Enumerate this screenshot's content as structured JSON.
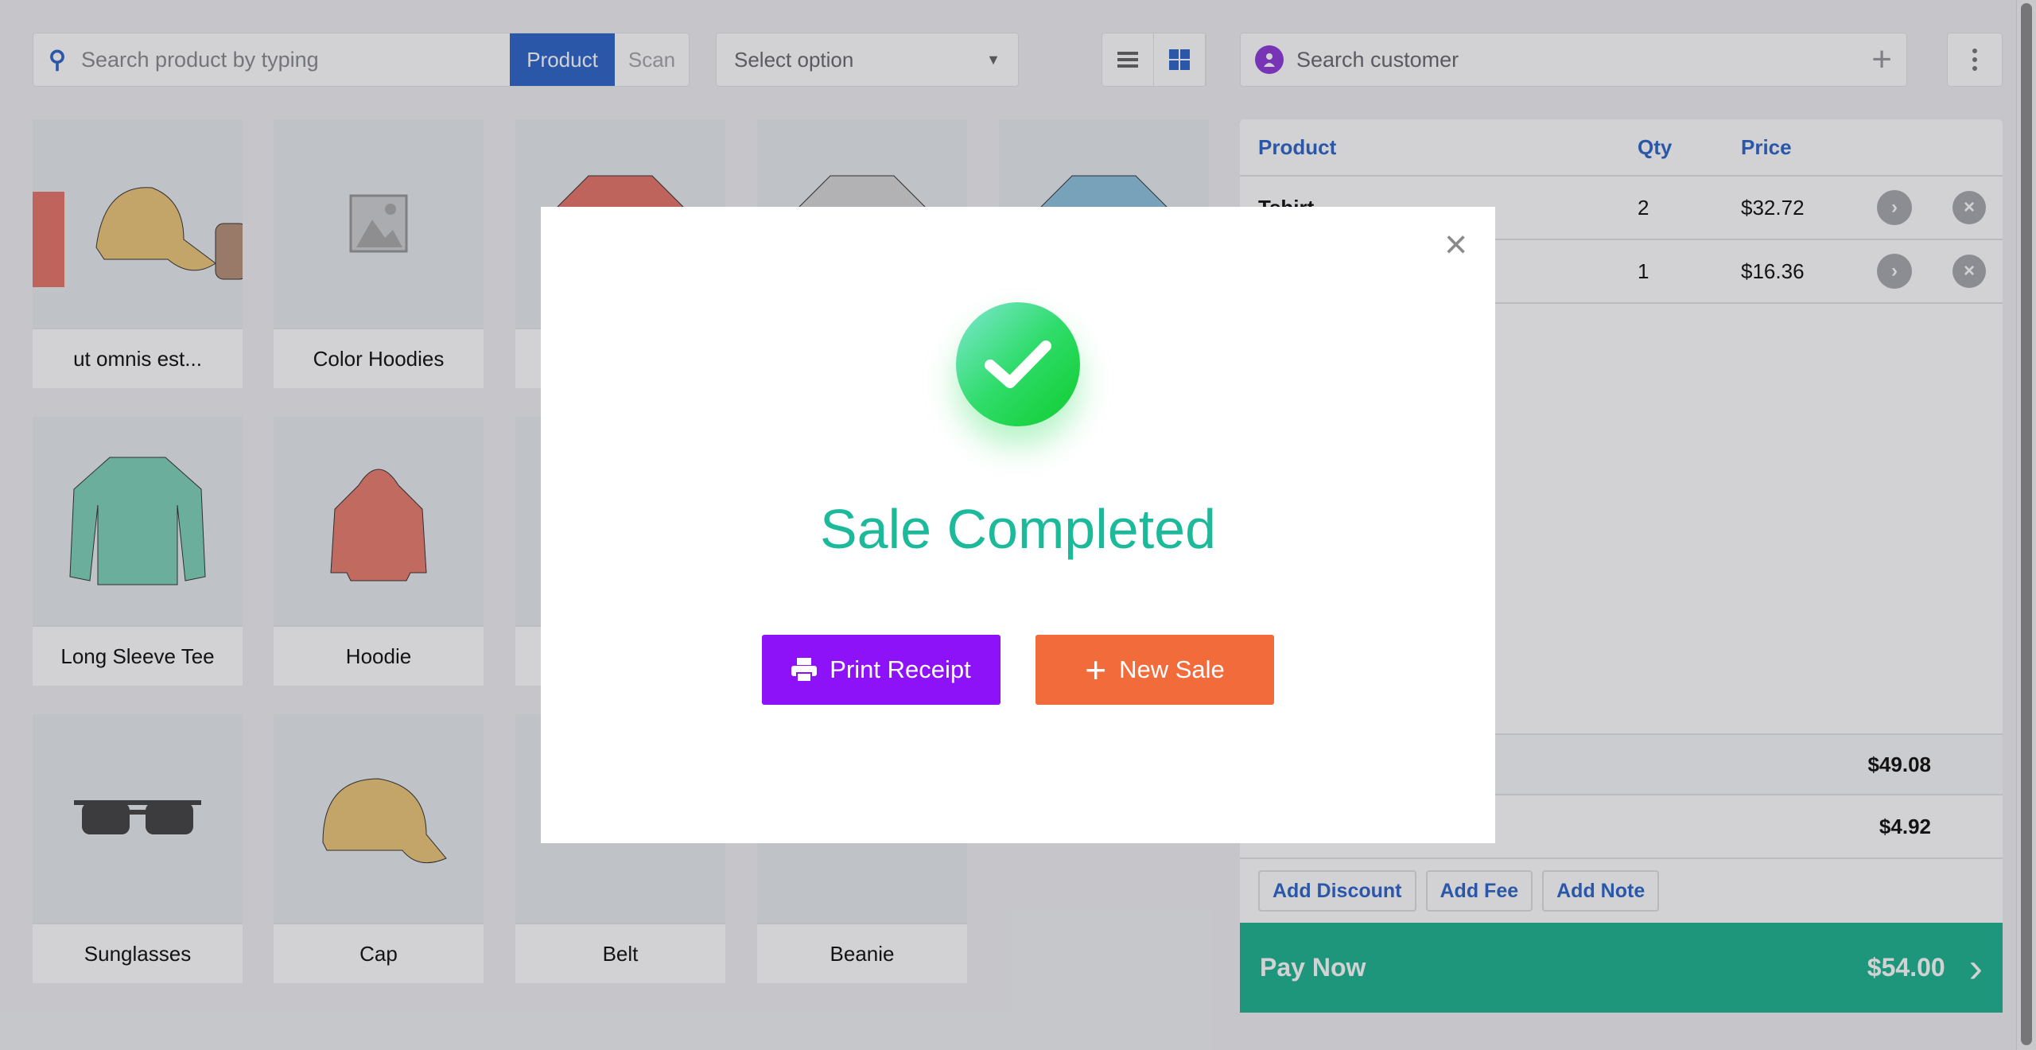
{
  "toolbar": {
    "search_placeholder": "Search product by typing",
    "product_label": "Product",
    "scan_label": "Scan",
    "select_placeholder": "Select option",
    "customer_placeholder": "Search customer"
  },
  "products": [
    {
      "label": "ut omnis est..."
    },
    {
      "label": "Color Hoodies"
    },
    {
      "label": ""
    },
    {
      "label": ""
    },
    {
      "label": ""
    },
    {
      "label": "Long Sleeve Tee"
    },
    {
      "label": "Hoodie"
    },
    {
      "label": ""
    },
    {
      "label": ""
    },
    {
      "label": "Sunglasses"
    },
    {
      "label": "Cap"
    },
    {
      "label": "Belt"
    },
    {
      "label": "Beanie"
    }
  ],
  "cart": {
    "headers": {
      "product": "Product",
      "qty": "Qty",
      "price": "Price"
    },
    "items": [
      {
        "name": "Tshirt",
        "qty": "2",
        "price": "$32.72"
      },
      {
        "name": "",
        "qty": "1",
        "price": "$16.36"
      }
    ],
    "subtotal": "$49.08",
    "tax": "$4.92",
    "actions": {
      "discount": "Add Discount",
      "fee": "Add Fee",
      "note": "Add Note"
    },
    "pay_label": "Pay Now",
    "pay_total": "$54.00"
  },
  "modal": {
    "title": "Sale Completed",
    "print_label": "Print Receipt",
    "new_sale_label": "New Sale"
  },
  "colors": {
    "accent": "#2f66c8",
    "pay": "#1db590",
    "success": "#1cb99b",
    "print": "#8e12f8",
    "new_sale": "#f26b3a"
  }
}
